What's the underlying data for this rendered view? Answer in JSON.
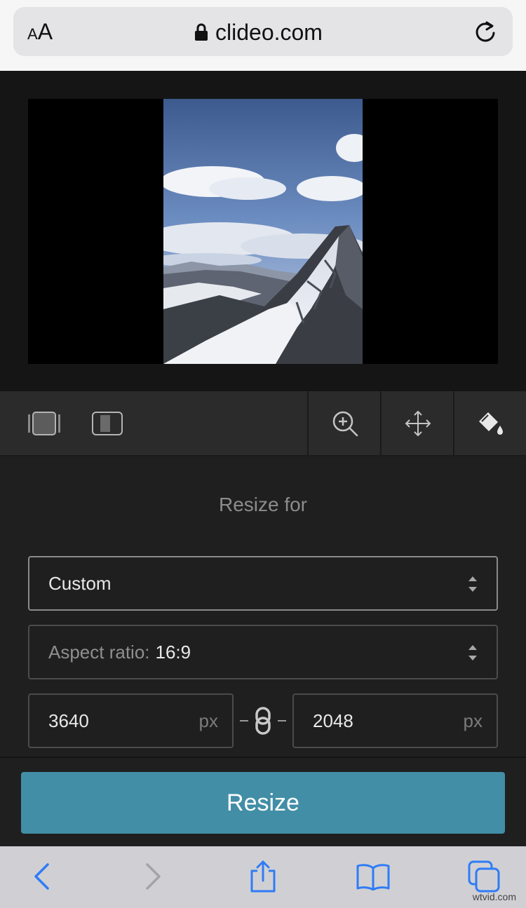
{
  "browser": {
    "text_size_label": "AA",
    "url": "clideo.com"
  },
  "toolbar": {
    "tools": [
      "fit-frame",
      "fill-frame",
      "zoom",
      "move",
      "background-color"
    ]
  },
  "settings": {
    "heading": "Resize for",
    "preset_value": "Custom",
    "aspect_label": "Aspect ratio:",
    "aspect_value": "16:9",
    "width_value": "3640",
    "height_value": "2048",
    "unit": "px",
    "separator": "–"
  },
  "action": {
    "resize_label": "Resize"
  },
  "watermark": "wtvid.com",
  "colors": {
    "accent": "#428ea6",
    "safari_blue": "#2f7cf6"
  }
}
